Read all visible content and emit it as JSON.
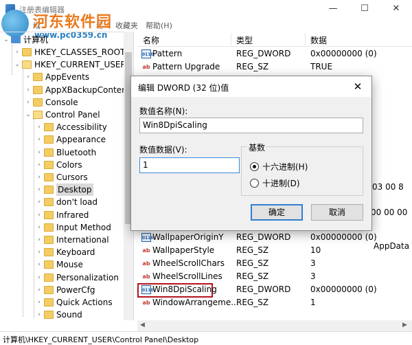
{
  "window": {
    "title": "注册表编辑器",
    "minimize": "—",
    "maximize": "☐",
    "close": "✕"
  },
  "watermark": {
    "title": "河东软件园",
    "url": "www.pc0359.cn"
  },
  "menubar": {
    "items": [
      "文",
      "编",
      "看",
      "收藏夹",
      "帮助(H)"
    ]
  },
  "tree": {
    "root": "计算机",
    "items": [
      {
        "label": "HKEY_CLASSES_ROOT",
        "level": 1,
        "expanded": false
      },
      {
        "label": "HKEY_CURRENT_USER",
        "level": 1,
        "expanded": true
      },
      {
        "label": "AppEvents",
        "level": 2,
        "expanded": false
      },
      {
        "label": "AppXBackupConter",
        "level": 2,
        "expanded": false
      },
      {
        "label": "Console",
        "level": 2,
        "expanded": false
      },
      {
        "label": "Control Panel",
        "level": 2,
        "expanded": true
      },
      {
        "label": "Accessibility",
        "level": 3,
        "expanded": false
      },
      {
        "label": "Appearance",
        "level": 3,
        "expanded": false
      },
      {
        "label": "Bluetooth",
        "level": 3,
        "expanded": false
      },
      {
        "label": "Colors",
        "level": 3,
        "expanded": false
      },
      {
        "label": "Cursors",
        "level": 3,
        "expanded": false
      },
      {
        "label": "Desktop",
        "level": 3,
        "expanded": false,
        "selected": true
      },
      {
        "label": "don't load",
        "level": 3,
        "expanded": false
      },
      {
        "label": "Infrared",
        "level": 3,
        "expanded": false
      },
      {
        "label": "Input Method",
        "level": 3,
        "expanded": false
      },
      {
        "label": "International",
        "level": 3,
        "expanded": false
      },
      {
        "label": "Keyboard",
        "level": 3,
        "expanded": false
      },
      {
        "label": "Mouse",
        "level": 3,
        "expanded": false
      },
      {
        "label": "Personalization",
        "level": 3,
        "expanded": false
      },
      {
        "label": "PowerCfg",
        "level": 3,
        "expanded": false
      },
      {
        "label": "Quick Actions",
        "level": 3,
        "expanded": false
      },
      {
        "label": "Sound",
        "level": 3,
        "expanded": false
      }
    ]
  },
  "list": {
    "headers": {
      "name": "名称",
      "type": "类型",
      "data": "数据"
    },
    "top_rows": [
      {
        "name": "Pattern",
        "type": "REG_DWORD",
        "data": "0x00000000 (0)",
        "kind": "dw"
      },
      {
        "name": "Pattern Upgrade",
        "type": "REG_SZ",
        "data": "TRUE",
        "kind": "sz"
      }
    ],
    "peek": {
      "row1": "03 00 8",
      "row2": "00 00 00",
      "row3": "AppData"
    },
    "bottom_rows": [
      {
        "name": "WallpaperOriginY",
        "type": "REG_DWORD",
        "data": "0x00000000 (0)",
        "kind": "dw"
      },
      {
        "name": "WallpaperStyle",
        "type": "REG_SZ",
        "data": "10",
        "kind": "sz"
      },
      {
        "name": "WheelScrollChars",
        "type": "REG_SZ",
        "data": "3",
        "kind": "sz"
      },
      {
        "name": "WheelScrollLines",
        "type": "REG_SZ",
        "data": "3",
        "kind": "sz"
      },
      {
        "name": "Win8DpiScaling",
        "type": "REG_DWORD",
        "data": "0x00000000 (0)",
        "kind": "dw",
        "highlighted": true
      },
      {
        "name": "WindowArrangeme...",
        "type": "REG_SZ",
        "data": "1",
        "kind": "sz"
      }
    ]
  },
  "dialog": {
    "title": "编辑 DWORD (32 位)值",
    "close": "✕",
    "name_label": "数值名称(N):",
    "name_value": "Win8DpiScaling",
    "data_label": "数值数据(V):",
    "data_value": "1",
    "base_label": "基数",
    "hex_label": "十六进制(H)",
    "dec_label": "十进制(D)",
    "selected_base": "hex",
    "ok": "确定",
    "cancel": "取消"
  },
  "statusbar": {
    "path": "计算机\\HKEY_CURRENT_USER\\Control Panel\\Desktop"
  }
}
